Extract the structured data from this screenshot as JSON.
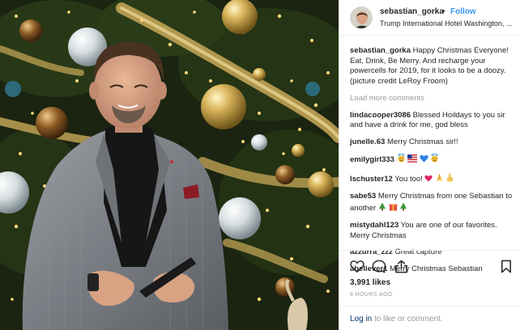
{
  "post": {
    "username": "sebastian_gorka",
    "dot": "•",
    "follow_label": "Follow",
    "location": "Trump International Hotel Washington, ...",
    "caption_user": "sebastian_gorka",
    "caption_text": "Happy Christmas Everyone! Eat, Drink, Be Merry. And recharge your powercells for 2019, for it looks to be a doozy. (picture credit LeRoy Froom)",
    "load_more": "Load more comments",
    "comments": [
      {
        "user": "lindacooper3086",
        "text": "Blessed Hoildays to you sir and have a drink for me, god bless",
        "emoji": ""
      },
      {
        "user": "junelle.63",
        "text": "Merry Christmas sir!!",
        "emoji": ""
      },
      {
        "user": "emilygirl333",
        "text": "",
        "emoji": "angel-flag-heart-angel"
      },
      {
        "user": "lschuster12",
        "text": "You too!",
        "emoji": "heart-pray-point"
      },
      {
        "user": "sabe53",
        "text": "Merry Christmas from one Sebastian to another",
        "emoji": "tree-gift-tree"
      },
      {
        "user": "mistydahl123",
        "text": "You are one of our favorites. Merry Christmas",
        "emoji": ""
      },
      {
        "user": "azzurra_zzz",
        "text": "Great capture",
        "emoji": ""
      },
      {
        "user": "abeliever1",
        "text": "Merry Christmas Sebastian",
        "emoji": ""
      }
    ],
    "likes": "3,991 likes",
    "time_ago": "6 HOURS AGO",
    "login_link": "Log in",
    "login_rest": "to like or comment."
  },
  "icons": {
    "like": "heart-outline-icon",
    "comment": "speech-bubble-icon",
    "share": "share-icon",
    "save": "bookmark-icon"
  },
  "colors": {
    "link_blue": "#3897f0",
    "text": "#262626",
    "muted": "#999999",
    "border": "#efefef"
  }
}
